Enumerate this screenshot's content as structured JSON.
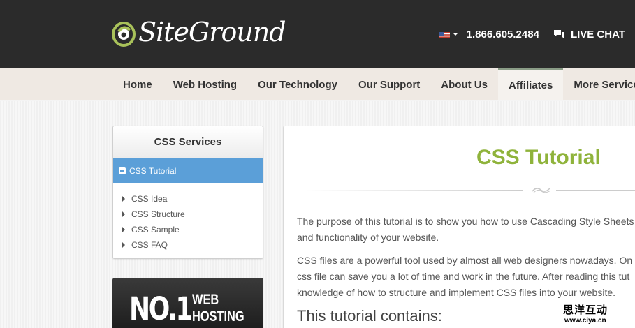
{
  "header": {
    "logo_text": "SiteGround",
    "phone": "1.866.605.2484",
    "live_chat": "LIVE CHAT"
  },
  "nav": {
    "items": [
      {
        "label": "Home"
      },
      {
        "label": "Web Hosting"
      },
      {
        "label": "Our Technology"
      },
      {
        "label": "Our Support"
      },
      {
        "label": "About Us"
      },
      {
        "label": "Affiliates",
        "active": true
      },
      {
        "label": "More Services"
      }
    ]
  },
  "sidebar": {
    "title": "CSS Services",
    "active_item": "CSS Tutorial",
    "links": [
      "CSS Idea",
      "CSS Structure",
      "CSS Sample",
      "CSS FAQ"
    ]
  },
  "banner": {
    "rank": "NO.1",
    "line1": "WEB",
    "line2": "HOSTING"
  },
  "main": {
    "title": "CSS Tutorial",
    "para1": [
      "The purpose of this tutorial is to show you how to use Cascading Style Sheets",
      "and functionality of your website."
    ],
    "para2": [
      "CSS files are a powerful tool used by almost all web designers nowadays. On",
      "css file can save you a lot of time and work in the future. After reading this tut",
      "knowledge of how to structure and implement CSS files into your website."
    ],
    "subheading": "This tutorial contains:"
  },
  "watermark": {
    "chinese": "思洋互动",
    "url": "www.ciya.cn"
  },
  "colors": {
    "header_bg": "#2b2b2b",
    "nav_bg": "#efe9e3",
    "accent_blue": "#5b9fd8",
    "title_green": "#8fb33b"
  }
}
